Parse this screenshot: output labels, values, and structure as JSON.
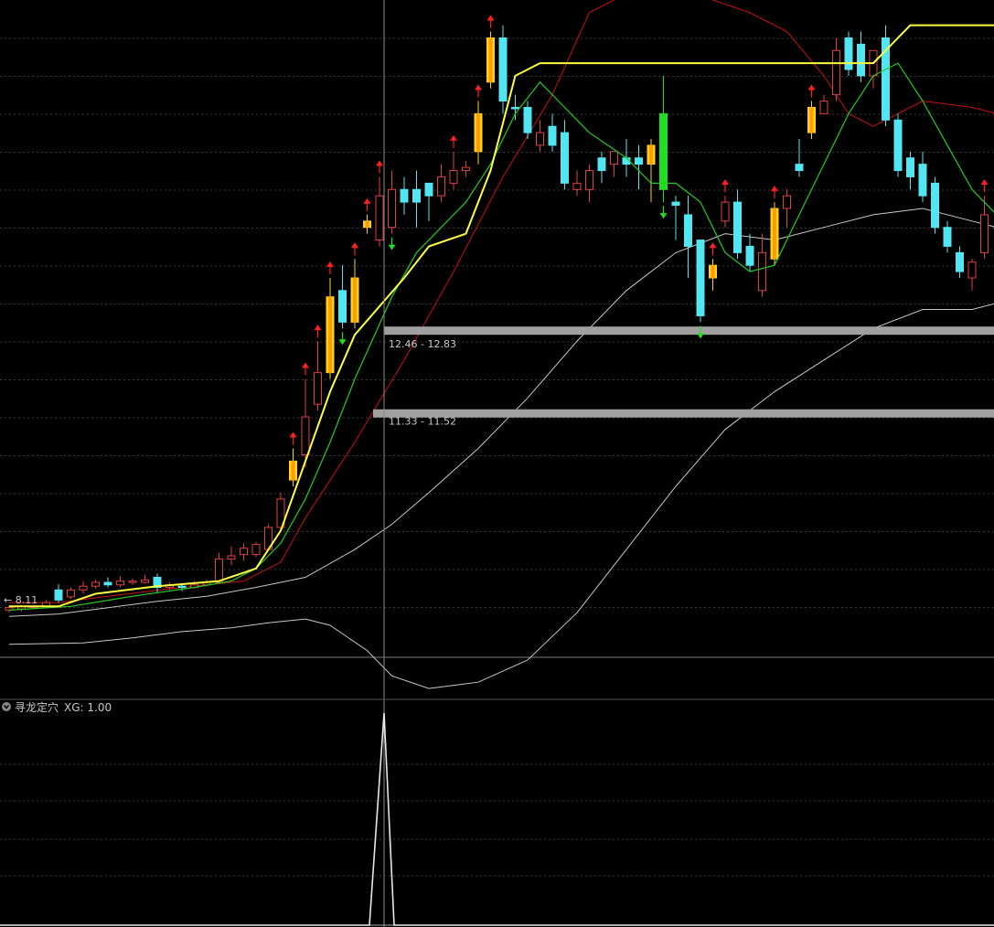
{
  "indicator": {
    "name": "寻龙定穴",
    "value_label": "XG: 1.00",
    "signal_index": 20,
    "signal_value": 1.0
  },
  "price_scale": {
    "min_label": "← 8.11",
    "min": 8.11
  },
  "zones": [
    {
      "label": "12.46 - 12.83",
      "low": 12.46,
      "high": 12.83
    },
    {
      "label": "11.33 - 11.52",
      "low": 11.33,
      "high": 11.52
    }
  ],
  "colors": {
    "background": "#000000",
    "grid": "#3a3a3a",
    "up_candle": "#e04040",
    "down_candle": "#52e5f2",
    "highlight_candle": "#ffd21a",
    "big_down_candle": "#22dd22",
    "step_line": "#ffff40",
    "ma_line": "#22cc22",
    "upper_band": "#cc1010",
    "bollinger_line": "#c8c8c8",
    "up_arrow": "#ff2020",
    "down_arrow": "#22dd22",
    "zone": "#a0a0a0"
  },
  "chart_data": {
    "type": "candlestick",
    "ylim": [
      7.0,
      18.0
    ],
    "candles": [
      {
        "o": 8.38,
        "h": 8.42,
        "c": 8.34,
        "l": 8.3
      },
      {
        "o": 8.36,
        "h": 8.42,
        "c": 8.4,
        "l": 8.32
      },
      {
        "o": 8.38,
        "h": 8.43,
        "c": 8.4,
        "l": 8.35
      },
      {
        "o": 8.4,
        "h": 8.5,
        "c": 8.46,
        "l": 8.37
      },
      {
        "o": 8.5,
        "h": 8.75,
        "c": 8.66,
        "l": 8.46,
        "dn": 1
      },
      {
        "o": 8.55,
        "h": 8.7,
        "c": 8.66,
        "l": 8.52
      },
      {
        "o": 8.66,
        "h": 8.8,
        "c": 8.72,
        "l": 8.6
      },
      {
        "o": 8.72,
        "h": 8.82,
        "c": 8.78,
        "l": 8.68
      },
      {
        "o": 8.78,
        "h": 8.86,
        "c": 8.74,
        "l": 8.7,
        "dn": 1
      },
      {
        "o": 8.74,
        "h": 8.88,
        "c": 8.8,
        "l": 8.7
      },
      {
        "o": 8.8,
        "h": 8.84,
        "c": 8.78,
        "l": 8.74
      },
      {
        "o": 8.78,
        "h": 8.9,
        "c": 8.82,
        "l": 8.76
      },
      {
        "o": 8.86,
        "h": 8.92,
        "c": 8.7,
        "l": 8.62,
        "dn": 1
      },
      {
        "o": 8.7,
        "h": 8.78,
        "c": 8.74,
        "l": 8.66
      },
      {
        "o": 8.72,
        "h": 8.76,
        "c": 8.7,
        "l": 8.64,
        "dn": 1
      },
      {
        "o": 8.7,
        "h": 8.8,
        "c": 8.74,
        "l": 8.68
      },
      {
        "o": 8.74,
        "h": 8.82,
        "c": 8.78,
        "l": 8.72
      },
      {
        "o": 8.78,
        "h": 9.25,
        "c": 9.15,
        "l": 8.76
      },
      {
        "o": 9.15,
        "h": 9.35,
        "c": 9.2,
        "l": 9.05
      },
      {
        "o": 9.22,
        "h": 9.4,
        "c": 9.32,
        "l": 9.12
      },
      {
        "o": 9.22,
        "h": 9.42,
        "c": 9.38,
        "l": 9.18
      },
      {
        "o": 9.3,
        "h": 9.7,
        "c": 9.65,
        "l": 9.28
      },
      {
        "o": 9.65,
        "h": 10.2,
        "c": 10.1,
        "l": 9.62
      },
      {
        "o": 10.4,
        "h": 10.9,
        "c": 10.7,
        "l": 10.3,
        "hl": 1,
        "ua": 1
      },
      {
        "o": 10.8,
        "h": 12.0,
        "c": 11.4,
        "l": 10.6,
        "ua": 1
      },
      {
        "o": 11.6,
        "h": 12.6,
        "c": 12.1,
        "l": 11.5,
        "ua": 1
      },
      {
        "o": 12.1,
        "h": 13.6,
        "c": 13.3,
        "l": 12.0,
        "hl": 1,
        "ua": 1
      },
      {
        "o": 13.4,
        "h": 13.8,
        "c": 12.9,
        "l": 12.8,
        "dn": 1,
        "da": 1
      },
      {
        "o": 12.9,
        "h": 13.9,
        "c": 13.6,
        "l": 12.8,
        "hl": 1,
        "ua": 1
      },
      {
        "o": 14.5,
        "h": 14.6,
        "c": 14.4,
        "l": 14.3,
        "hl": 1,
        "ua": 1
      },
      {
        "o": 14.2,
        "h": 15.2,
        "c": 14.9,
        "l": 14.1,
        "ua": 1
      },
      {
        "o": 14.4,
        "h": 15.3,
        "c": 15.0,
        "l": 14.3,
        "da": 1
      },
      {
        "o": 15.0,
        "h": 15.2,
        "c": 14.8,
        "l": 14.6,
        "dn": 1
      },
      {
        "o": 14.8,
        "h": 15.3,
        "c": 15.0,
        "l": 14.4,
        "dn": 1
      },
      {
        "o": 15.1,
        "h": 15.0,
        "c": 14.9,
        "l": 14.5,
        "dn": 1
      },
      {
        "o": 14.9,
        "h": 15.4,
        "c": 15.2,
        "l": 14.8
      },
      {
        "o": 15.1,
        "h": 15.6,
        "c": 15.3,
        "l": 15.0,
        "ua": 1
      },
      {
        "o": 15.3,
        "h": 15.45,
        "c": 15.35,
        "l": 15.2
      },
      {
        "o": 15.6,
        "h": 16.4,
        "c": 16.2,
        "l": 15.4,
        "hl": 1,
        "ua": 1
      },
      {
        "o": 16.7,
        "h": 17.5,
        "c": 17.4,
        "l": 16.6,
        "hl": 1,
        "ua": 1
      },
      {
        "o": 17.4,
        "h": 17.6,
        "c": 16.4,
        "l": 16.2,
        "dn": 1
      },
      {
        "o": 16.3,
        "h": 16.5,
        "c": 16.3,
        "l": 16.1,
        "dn": 1
      },
      {
        "o": 16.3,
        "h": 16.4,
        "c": 15.9,
        "l": 15.8,
        "dn": 1
      },
      {
        "o": 15.9,
        "h": 16.1,
        "c": 15.7,
        "l": 15.6
      },
      {
        "o": 15.7,
        "h": 16.2,
        "c": 16.0,
        "l": 15.6,
        "dn": 1
      },
      {
        "o": 15.9,
        "h": 16.1,
        "c": 15.1,
        "l": 15.0,
        "dn": 1
      },
      {
        "o": 15.1,
        "h": 15.3,
        "c": 15.0,
        "l": 14.9
      },
      {
        "o": 15.0,
        "h": 15.4,
        "c": 15.3,
        "l": 14.8
      },
      {
        "o": 15.3,
        "h": 15.6,
        "c": 15.5,
        "l": 15.1,
        "dn": 1
      },
      {
        "o": 15.4,
        "h": 15.6,
        "c": 15.6,
        "l": 15.2
      },
      {
        "o": 15.5,
        "h": 15.8,
        "c": 15.4,
        "l": 15.2,
        "dn": 1
      },
      {
        "o": 15.4,
        "h": 15.7,
        "c": 15.5,
        "l": 15.0,
        "dn": 1
      },
      {
        "o": 15.7,
        "h": 15.8,
        "c": 15.4,
        "l": 14.8,
        "hl": 1
      },
      {
        "o": 16.2,
        "h": 16.8,
        "c": 15.0,
        "l": 14.8,
        "big": 1,
        "da": 1
      },
      {
        "o": 14.8,
        "h": 14.9,
        "c": 14.75,
        "l": 14.2,
        "dn": 1
      },
      {
        "o": 14.6,
        "h": 14.9,
        "c": 14.1,
        "l": 13.6,
        "dn": 1
      },
      {
        "o": 14.2,
        "h": 13.9,
        "c": 13.0,
        "l": 12.9,
        "dn": 1,
        "da": 1
      },
      {
        "o": 13.6,
        "h": 13.9,
        "c": 13.8,
        "l": 13.4,
        "hl": 1,
        "ua": 1
      },
      {
        "o": 14.5,
        "h": 14.9,
        "c": 14.8,
        "l": 14.4,
        "ua": 1
      },
      {
        "o": 14.8,
        "h": 15.0,
        "c": 14.0,
        "l": 13.9,
        "dn": 1
      },
      {
        "o": 14.1,
        "h": 14.3,
        "c": 13.8,
        "l": 13.7,
        "dn": 1
      },
      {
        "o": 13.4,
        "h": 14.3,
        "c": 14.0,
        "l": 13.3
      },
      {
        "o": 13.9,
        "h": 14.8,
        "c": 14.7,
        "l": 13.8,
        "hl": 1,
        "ua": 1
      },
      {
        "o": 14.7,
        "h": 15.0,
        "c": 14.9,
        "l": 14.4
      },
      {
        "o": 15.3,
        "h": 15.8,
        "c": 15.4,
        "l": 15.2,
        "dn": 1
      },
      {
        "o": 15.9,
        "h": 16.4,
        "c": 16.3,
        "l": 15.8,
        "hl": 1,
        "ua": 1
      },
      {
        "o": 16.2,
        "h": 16.5,
        "c": 16.4,
        "l": 16.3
      },
      {
        "o": 16.5,
        "h": 17.4,
        "c": 17.2,
        "l": 16.4
      },
      {
        "o": 17.4,
        "h": 17.5,
        "c": 16.9,
        "l": 16.8,
        "dn": 1
      },
      {
        "o": 17.3,
        "h": 17.5,
        "c": 16.8,
        "l": 16.7,
        "dn": 1
      },
      {
        "o": 16.8,
        "h": 17.1,
        "c": 17.2,
        "l": 16.6
      },
      {
        "o": 17.4,
        "h": 17.6,
        "c": 16.1,
        "l": 16.0,
        "dn": 1
      },
      {
        "o": 16.1,
        "h": 16.2,
        "c": 15.3,
        "l": 15.2,
        "dn": 1
      },
      {
        "o": 15.5,
        "h": 15.6,
        "c": 15.2,
        "l": 15.0,
        "dn": 1
      },
      {
        "o": 15.4,
        "h": 15.6,
        "c": 14.9,
        "l": 14.8,
        "dn": 1
      },
      {
        "o": 15.1,
        "h": 15.2,
        "c": 14.4,
        "l": 14.3,
        "dn": 1
      },
      {
        "o": 14.4,
        "h": 14.5,
        "c": 14.1,
        "l": 14.0,
        "dn": 1
      },
      {
        "o": 14.0,
        "h": 14.1,
        "c": 13.7,
        "l": 13.6,
        "dn": 1
      },
      {
        "o": 13.6,
        "h": 13.9,
        "c": 13.85,
        "l": 13.4
      },
      {
        "o": 14.0,
        "h": 14.9,
        "c": 14.6,
        "l": 13.9,
        "ua": 1
      }
    ],
    "step_line": [
      [
        0,
        8.4
      ],
      [
        4,
        8.4
      ],
      [
        7,
        8.6
      ],
      [
        12,
        8.72
      ],
      [
        17,
        8.8
      ],
      [
        20,
        9.0
      ],
      [
        22,
        9.6
      ],
      [
        24,
        10.7
      ],
      [
        26,
        11.8
      ],
      [
        28,
        12.7
      ],
      [
        32,
        13.6
      ],
      [
        34,
        14.1
      ],
      [
        37,
        14.3
      ],
      [
        39,
        15.3
      ],
      [
        41,
        16.8
      ],
      [
        43,
        17.0
      ],
      [
        53,
        17.0
      ],
      [
        70,
        17.0
      ],
      [
        73,
        17.6
      ],
      [
        80,
        17.6
      ]
    ],
    "ma_line": [
      [
        0,
        8.34
      ],
      [
        5,
        8.4
      ],
      [
        10,
        8.56
      ],
      [
        15,
        8.7
      ],
      [
        18,
        8.8
      ],
      [
        20,
        9.0
      ],
      [
        22,
        9.4
      ],
      [
        24,
        10.1
      ],
      [
        26,
        11.0
      ],
      [
        28,
        12.0
      ],
      [
        31,
        13.3
      ],
      [
        33,
        14.0
      ],
      [
        35,
        14.4
      ],
      [
        37,
        14.8
      ],
      [
        39,
        15.4
      ],
      [
        41,
        16.2
      ],
      [
        43,
        16.7
      ],
      [
        45,
        16.3
      ],
      [
        47,
        15.9
      ],
      [
        50,
        15.5
      ],
      [
        52,
        15.1
      ],
      [
        54,
        15.1
      ],
      [
        56,
        14.8
      ],
      [
        58,
        14.0
      ],
      [
        60,
        13.7
      ],
      [
        62,
        13.8
      ],
      [
        64,
        14.6
      ],
      [
        66,
        15.4
      ],
      [
        68,
        16.2
      ],
      [
        70,
        16.8
      ],
      [
        72,
        17.0
      ],
      [
        74,
        16.4
      ],
      [
        76,
        15.7
      ],
      [
        78,
        15.0
      ],
      [
        80,
        14.6
      ]
    ],
    "upper_band": [
      [
        0,
        8.46
      ],
      [
        4,
        8.46
      ],
      [
        8,
        8.56
      ],
      [
        14,
        8.7
      ],
      [
        19,
        8.8
      ],
      [
        22,
        9.1
      ],
      [
        24,
        9.8
      ],
      [
        28,
        11.0
      ],
      [
        32,
        12.3
      ],
      [
        36,
        13.7
      ],
      [
        40,
        15.2
      ],
      [
        44,
        16.5
      ],
      [
        47,
        17.8
      ],
      [
        50,
        18.1
      ],
      [
        53,
        18.2
      ],
      [
        57,
        18.0
      ],
      [
        60,
        17.8
      ],
      [
        63,
        17.5
      ],
      [
        66,
        16.8
      ],
      [
        68,
        16.2
      ],
      [
        70,
        16.0
      ],
      [
        74,
        16.4
      ],
      [
        78,
        16.3
      ],
      [
        80,
        16.2
      ]
    ],
    "mid_band": [
      [
        0,
        8.24
      ],
      [
        4,
        8.28
      ],
      [
        8,
        8.38
      ],
      [
        12,
        8.48
      ],
      [
        16,
        8.56
      ],
      [
        20,
        8.7
      ],
      [
        24,
        8.86
      ],
      [
        28,
        9.3
      ],
      [
        31,
        9.7
      ],
      [
        34,
        10.2
      ],
      [
        38,
        10.9
      ],
      [
        42,
        11.7
      ],
      [
        46,
        12.6
      ],
      [
        50,
        13.4
      ],
      [
        54,
        14.0
      ],
      [
        58,
        14.3
      ],
      [
        62,
        14.2
      ],
      [
        66,
        14.4
      ],
      [
        70,
        14.6
      ],
      [
        74,
        14.7
      ],
      [
        78,
        14.5
      ],
      [
        80,
        14.4
      ]
    ],
    "lower_band": [
      [
        0,
        7.8
      ],
      [
        6,
        7.82
      ],
      [
        10,
        7.9
      ],
      [
        14,
        8.0
      ],
      [
        18,
        8.06
      ],
      [
        21,
        8.14
      ],
      [
        24,
        8.2
      ],
      [
        26,
        8.1
      ],
      [
        29,
        7.7
      ],
      [
        31,
        7.3
      ],
      [
        34,
        7.1
      ],
      [
        38,
        7.2
      ],
      [
        42,
        7.55
      ],
      [
        46,
        8.3
      ],
      [
        50,
        9.3
      ],
      [
        54,
        10.3
      ],
      [
        58,
        11.2
      ],
      [
        62,
        11.8
      ],
      [
        66,
        12.3
      ],
      [
        70,
        12.8
      ],
      [
        74,
        13.1
      ],
      [
        78,
        13.1
      ],
      [
        80,
        13.2
      ]
    ],
    "cursor_index": 20
  }
}
